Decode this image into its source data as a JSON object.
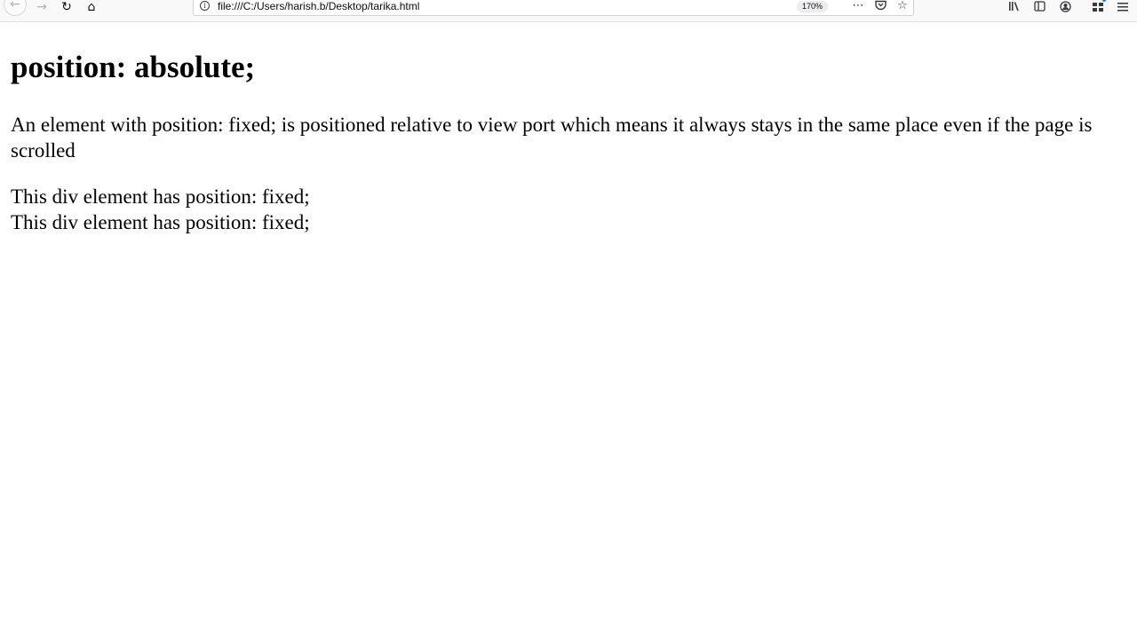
{
  "browser": {
    "url": "file:///C:/Users/harish.b/Desktop/tarika.html",
    "zoom": "170%",
    "nav_icons": [
      "back-icon",
      "forward-icon",
      "reload-icon",
      "home-icon"
    ],
    "url_icons": [
      "page-actions-icon",
      "pocket-icon",
      "bookmark-star-icon"
    ],
    "toolbar_icons": [
      "library-icon",
      "sidebar-icon",
      "account-icon",
      "extensions-icon",
      "menu-icon"
    ]
  },
  "page": {
    "heading": "position: absolute;",
    "description": "An element with position: fixed; is positioned relative to view port which means it always stays in the same place even if the page is scrolled",
    "fixed_divs": [
      "This div element has position: fixed;",
      "This div element has position: fixed;"
    ]
  }
}
